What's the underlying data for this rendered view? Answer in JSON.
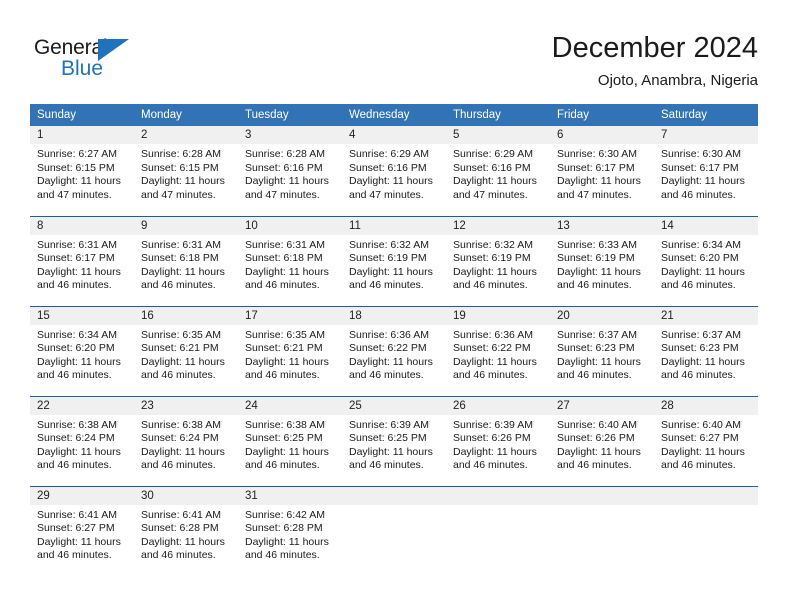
{
  "logo": {
    "word_one": "General",
    "word_two": "Blue",
    "triangle_color": "#1f72bd"
  },
  "header": {
    "title": "December 2024",
    "location": "Ojoto, Anambra, Nigeria"
  },
  "colors": {
    "header_blue": "#3273b5",
    "separator_blue": "#1a5fa3",
    "daynum_band": "#f0f0f0",
    "text": "#1b1b1b"
  },
  "weekdays": [
    "Sunday",
    "Monday",
    "Tuesday",
    "Wednesday",
    "Thursday",
    "Friday",
    "Saturday"
  ],
  "weeks": [
    [
      {
        "day": "1",
        "sunrise": "Sunrise: 6:27 AM",
        "sunset": "Sunset: 6:15 PM",
        "daylight": "Daylight: 11 hours and 47 minutes."
      },
      {
        "day": "2",
        "sunrise": "Sunrise: 6:28 AM",
        "sunset": "Sunset: 6:15 PM",
        "daylight": "Daylight: 11 hours and 47 minutes."
      },
      {
        "day": "3",
        "sunrise": "Sunrise: 6:28 AM",
        "sunset": "Sunset: 6:16 PM",
        "daylight": "Daylight: 11 hours and 47 minutes."
      },
      {
        "day": "4",
        "sunrise": "Sunrise: 6:29 AM",
        "sunset": "Sunset: 6:16 PM",
        "daylight": "Daylight: 11 hours and 47 minutes."
      },
      {
        "day": "5",
        "sunrise": "Sunrise: 6:29 AM",
        "sunset": "Sunset: 6:16 PM",
        "daylight": "Daylight: 11 hours and 47 minutes."
      },
      {
        "day": "6",
        "sunrise": "Sunrise: 6:30 AM",
        "sunset": "Sunset: 6:17 PM",
        "daylight": "Daylight: 11 hours and 47 minutes."
      },
      {
        "day": "7",
        "sunrise": "Sunrise: 6:30 AM",
        "sunset": "Sunset: 6:17 PM",
        "daylight": "Daylight: 11 hours and 46 minutes."
      }
    ],
    [
      {
        "day": "8",
        "sunrise": "Sunrise: 6:31 AM",
        "sunset": "Sunset: 6:17 PM",
        "daylight": "Daylight: 11 hours and 46 minutes."
      },
      {
        "day": "9",
        "sunrise": "Sunrise: 6:31 AM",
        "sunset": "Sunset: 6:18 PM",
        "daylight": "Daylight: 11 hours and 46 minutes."
      },
      {
        "day": "10",
        "sunrise": "Sunrise: 6:31 AM",
        "sunset": "Sunset: 6:18 PM",
        "daylight": "Daylight: 11 hours and 46 minutes."
      },
      {
        "day": "11",
        "sunrise": "Sunrise: 6:32 AM",
        "sunset": "Sunset: 6:19 PM",
        "daylight": "Daylight: 11 hours and 46 minutes."
      },
      {
        "day": "12",
        "sunrise": "Sunrise: 6:32 AM",
        "sunset": "Sunset: 6:19 PM",
        "daylight": "Daylight: 11 hours and 46 minutes."
      },
      {
        "day": "13",
        "sunrise": "Sunrise: 6:33 AM",
        "sunset": "Sunset: 6:19 PM",
        "daylight": "Daylight: 11 hours and 46 minutes."
      },
      {
        "day": "14",
        "sunrise": "Sunrise: 6:34 AM",
        "sunset": "Sunset: 6:20 PM",
        "daylight": "Daylight: 11 hours and 46 minutes."
      }
    ],
    [
      {
        "day": "15",
        "sunrise": "Sunrise: 6:34 AM",
        "sunset": "Sunset: 6:20 PM",
        "daylight": "Daylight: 11 hours and 46 minutes."
      },
      {
        "day": "16",
        "sunrise": "Sunrise: 6:35 AM",
        "sunset": "Sunset: 6:21 PM",
        "daylight": "Daylight: 11 hours and 46 minutes."
      },
      {
        "day": "17",
        "sunrise": "Sunrise: 6:35 AM",
        "sunset": "Sunset: 6:21 PM",
        "daylight": "Daylight: 11 hours and 46 minutes."
      },
      {
        "day": "18",
        "sunrise": "Sunrise: 6:36 AM",
        "sunset": "Sunset: 6:22 PM",
        "daylight": "Daylight: 11 hours and 46 minutes."
      },
      {
        "day": "19",
        "sunrise": "Sunrise: 6:36 AM",
        "sunset": "Sunset: 6:22 PM",
        "daylight": "Daylight: 11 hours and 46 minutes."
      },
      {
        "day": "20",
        "sunrise": "Sunrise: 6:37 AM",
        "sunset": "Sunset: 6:23 PM",
        "daylight": "Daylight: 11 hours and 46 minutes."
      },
      {
        "day": "21",
        "sunrise": "Sunrise: 6:37 AM",
        "sunset": "Sunset: 6:23 PM",
        "daylight": "Daylight: 11 hours and 46 minutes."
      }
    ],
    [
      {
        "day": "22",
        "sunrise": "Sunrise: 6:38 AM",
        "sunset": "Sunset: 6:24 PM",
        "daylight": "Daylight: 11 hours and 46 minutes."
      },
      {
        "day": "23",
        "sunrise": "Sunrise: 6:38 AM",
        "sunset": "Sunset: 6:24 PM",
        "daylight": "Daylight: 11 hours and 46 minutes."
      },
      {
        "day": "24",
        "sunrise": "Sunrise: 6:38 AM",
        "sunset": "Sunset: 6:25 PM",
        "daylight": "Daylight: 11 hours and 46 minutes."
      },
      {
        "day": "25",
        "sunrise": "Sunrise: 6:39 AM",
        "sunset": "Sunset: 6:25 PM",
        "daylight": "Daylight: 11 hours and 46 minutes."
      },
      {
        "day": "26",
        "sunrise": "Sunrise: 6:39 AM",
        "sunset": "Sunset: 6:26 PM",
        "daylight": "Daylight: 11 hours and 46 minutes."
      },
      {
        "day": "27",
        "sunrise": "Sunrise: 6:40 AM",
        "sunset": "Sunset: 6:26 PM",
        "daylight": "Daylight: 11 hours and 46 minutes."
      },
      {
        "day": "28",
        "sunrise": "Sunrise: 6:40 AM",
        "sunset": "Sunset: 6:27 PM",
        "daylight": "Daylight: 11 hours and 46 minutes."
      }
    ],
    [
      {
        "day": "29",
        "sunrise": "Sunrise: 6:41 AM",
        "sunset": "Sunset: 6:27 PM",
        "daylight": "Daylight: 11 hours and 46 minutes."
      },
      {
        "day": "30",
        "sunrise": "Sunrise: 6:41 AM",
        "sunset": "Sunset: 6:28 PM",
        "daylight": "Daylight: 11 hours and 46 minutes."
      },
      {
        "day": "31",
        "sunrise": "Sunrise: 6:42 AM",
        "sunset": "Sunset: 6:28 PM",
        "daylight": "Daylight: 11 hours and 46 minutes."
      },
      {
        "day": "",
        "sunrise": "",
        "sunset": "",
        "daylight": ""
      },
      {
        "day": "",
        "sunrise": "",
        "sunset": "",
        "daylight": ""
      },
      {
        "day": "",
        "sunrise": "",
        "sunset": "",
        "daylight": ""
      },
      {
        "day": "",
        "sunrise": "",
        "sunset": "",
        "daylight": ""
      }
    ]
  ]
}
